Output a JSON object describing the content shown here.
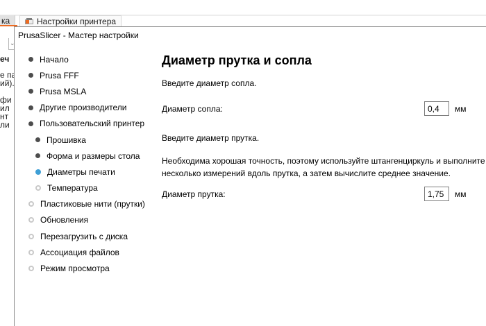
{
  "colors": {
    "accent_orange": "#ED6B21",
    "active_step_blue": "#3E9FD6",
    "dialog_border": "#8B8B8B"
  },
  "background_window": {
    "partial_tab_label": "ка",
    "printer_tab_label": "Настройки принтера",
    "dropdown_caret": "⌄",
    "left_edge_fragments": [
      "еч",
      "е па",
      "ий).",
      "фи",
      "ил",
      "нт",
      "ли"
    ]
  },
  "wizard": {
    "title": "PrusaSlicer - Мастер настройки",
    "sidebar_items": [
      {
        "label": "Начало",
        "state": "done",
        "indent": 0
      },
      {
        "label": "Prusa FFF",
        "state": "done",
        "indent": 0
      },
      {
        "label": "Prusa MSLA",
        "state": "done",
        "indent": 0
      },
      {
        "label": "Другие производители",
        "state": "done",
        "indent": 0
      },
      {
        "label": "Пользовательский принтер",
        "state": "done",
        "indent": 0
      },
      {
        "label": "Прошивка",
        "state": "done",
        "indent": 1
      },
      {
        "label": "Форма и размеры стола",
        "state": "done",
        "indent": 1
      },
      {
        "label": "Диаметры печати",
        "state": "active",
        "indent": 1
      },
      {
        "label": "Температура",
        "state": "todo",
        "indent": 1
      },
      {
        "label": "Пластиковые нити (прутки)",
        "state": "todo",
        "indent": 0
      },
      {
        "label": "Обновления",
        "state": "todo",
        "indent": 0
      },
      {
        "label": "Перезагрузить с диска",
        "state": "todo",
        "indent": 0
      },
      {
        "label": "Ассоциация файлов",
        "state": "todo",
        "indent": 0
      },
      {
        "label": "Режим просмотра",
        "state": "todo",
        "indent": 0
      }
    ],
    "page": {
      "heading": "Диаметр прутка и сопла",
      "nozzle_intro": "Введите диаметр сопла.",
      "nozzle_label": "Диаметр сопла:",
      "nozzle_value": "0,4",
      "nozzle_unit": "мм",
      "filament_intro": "Введите диаметр прутка.",
      "filament_note_line1": "Необходима хорошая точность, поэтому используйте штангенциркуль и выполните",
      "filament_note_line2": "несколько измерений вдоль прутка, а затем вычислите среднее значение.",
      "filament_label": "Диаметр прутка:",
      "filament_value": "1,75",
      "filament_unit": "мм"
    }
  }
}
